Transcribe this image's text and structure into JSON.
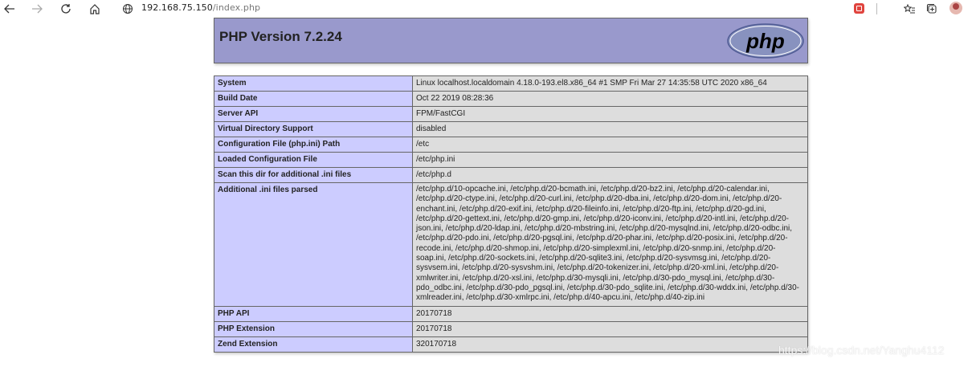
{
  "browser": {
    "url_host": "192.168.75.150",
    "url_path": "/index.php"
  },
  "php": {
    "title": "PHP Version 7.2.24",
    "logo_text": "php",
    "rows": [
      {
        "label": "System",
        "value": "Linux localhost.localdomain 4.18.0-193.el8.x86_64 #1 SMP Fri Mar 27 14:35:58 UTC 2020 x86_64"
      },
      {
        "label": "Build Date",
        "value": "Oct 22 2019 08:28:36"
      },
      {
        "label": "Server API",
        "value": "FPM/FastCGI"
      },
      {
        "label": "Virtual Directory Support",
        "value": "disabled"
      },
      {
        "label": "Configuration File (php.ini) Path",
        "value": "/etc"
      },
      {
        "label": "Loaded Configuration File",
        "value": "/etc/php.ini"
      },
      {
        "label": "Scan this dir for additional .ini files",
        "value": "/etc/php.d"
      },
      {
        "label": "Additional .ini files parsed",
        "value": "/etc/php.d/10-opcache.ini, /etc/php.d/20-bcmath.ini, /etc/php.d/20-bz2.ini, /etc/php.d/20-calendar.ini, /etc/php.d/20-ctype.ini, /etc/php.d/20-curl.ini, /etc/php.d/20-dba.ini, /etc/php.d/20-dom.ini, /etc/php.d/20-enchant.ini, /etc/php.d/20-exif.ini, /etc/php.d/20-fileinfo.ini, /etc/php.d/20-ftp.ini, /etc/php.d/20-gd.ini, /etc/php.d/20-gettext.ini, /etc/php.d/20-gmp.ini, /etc/php.d/20-iconv.ini, /etc/php.d/20-intl.ini, /etc/php.d/20-json.ini, /etc/php.d/20-ldap.ini, /etc/php.d/20-mbstring.ini, /etc/php.d/20-mysqlnd.ini, /etc/php.d/20-odbc.ini, /etc/php.d/20-pdo.ini, /etc/php.d/20-pgsql.ini, /etc/php.d/20-phar.ini, /etc/php.d/20-posix.ini, /etc/php.d/20-recode.ini, /etc/php.d/20-shmop.ini, /etc/php.d/20-simplexml.ini, /etc/php.d/20-snmp.ini, /etc/php.d/20-soap.ini, /etc/php.d/20-sockets.ini, /etc/php.d/20-sqlite3.ini, /etc/php.d/20-sysvmsg.ini, /etc/php.d/20-sysvsem.ini, /etc/php.d/20-sysvshm.ini, /etc/php.d/20-tokenizer.ini, /etc/php.d/20-xml.ini, /etc/php.d/20-xmlwriter.ini, /etc/php.d/20-xsl.ini, /etc/php.d/30-mysqli.ini, /etc/php.d/30-pdo_mysql.ini, /etc/php.d/30-pdo_odbc.ini, /etc/php.d/30-pdo_pgsql.ini, /etc/php.d/30-pdo_sqlite.ini, /etc/php.d/30-wddx.ini, /etc/php.d/30-xmlreader.ini, /etc/php.d/30-xmlrpc.ini, /etc/php.d/40-apcu.ini, /etc/php.d/40-zip.ini"
      },
      {
        "label": "PHP API",
        "value": "20170718"
      },
      {
        "label": "PHP Extension",
        "value": "20170718"
      },
      {
        "label": "Zend Extension",
        "value": "320170718"
      }
    ]
  },
  "watermark": "https://blog.csdn.net/Yanghu4112"
}
